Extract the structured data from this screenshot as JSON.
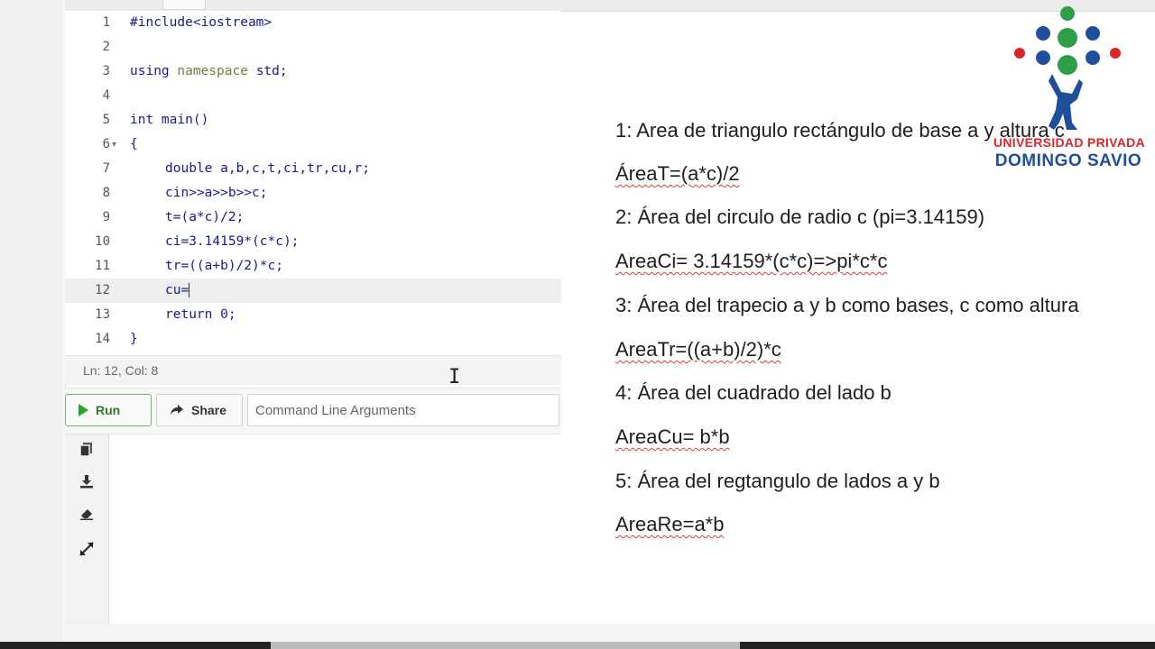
{
  "editor": {
    "lines": [
      {
        "n": "1",
        "text": "#include<iostream>"
      },
      {
        "n": "2",
        "text": ""
      },
      {
        "n": "3",
        "text_a": "using ",
        "text_ns": "namespace",
        "text_b": " std;"
      },
      {
        "n": "4",
        "text": ""
      },
      {
        "n": "5",
        "text": "int main()"
      },
      {
        "n": "6",
        "text": "{",
        "fold": "▾"
      },
      {
        "n": "7",
        "text": "double a,b,c,t,ci,tr,cu,r;"
      },
      {
        "n": "8",
        "text": "cin>>a>>b>>c;"
      },
      {
        "n": "9",
        "text": "t=(a*c)/2;"
      },
      {
        "n": "10",
        "text": "ci=3.14159*(c*c);"
      },
      {
        "n": "11",
        "text": "tr=((a+b)/2)*c;"
      },
      {
        "n": "12",
        "text": "cu="
      },
      {
        "n": "13",
        "text": "return 0;"
      },
      {
        "n": "14",
        "text": "}"
      }
    ],
    "status": "Ln: 12,  Col: 8"
  },
  "toolbar": {
    "run_label": "Run",
    "share_label": "Share",
    "cmd_placeholder": "Command Line Arguments"
  },
  "output_panel": {
    "icons": [
      "copy-icon",
      "download-icon",
      "clear-icon",
      "expand-icon"
    ]
  },
  "notes": {
    "n1": "1: Area de triangulo rectángulo de base a y altura c",
    "f1": "ÁreaT=(a*c)/2",
    "n2": "2: Área del circulo de radio c (pi=3.14159)",
    "f2": "AreaCi= 3.14159*(c*c)=>pi*c*c",
    "n3": "3: Área del trapecio a y b como bases, c como altura",
    "f3": "AreaTr=((a+b)/2)*c",
    "n4": "4: Área del cuadrado del lado b",
    "f4": "AreaCu= b*b",
    "n5": "5: Área del regtangulo de lados a y b",
    "f5": "AreaRe=a*b"
  },
  "logo": {
    "line1": "UNIVERSIDAD PRIVADA",
    "line2": "DOMINGO SAVIO"
  },
  "colors": {
    "code_text": "#1a1a8c",
    "run_green": "#2aa32a",
    "logo_red": "#d9262c",
    "logo_blue": "#1f4f9a",
    "spell_underline": "#d23c3c"
  }
}
